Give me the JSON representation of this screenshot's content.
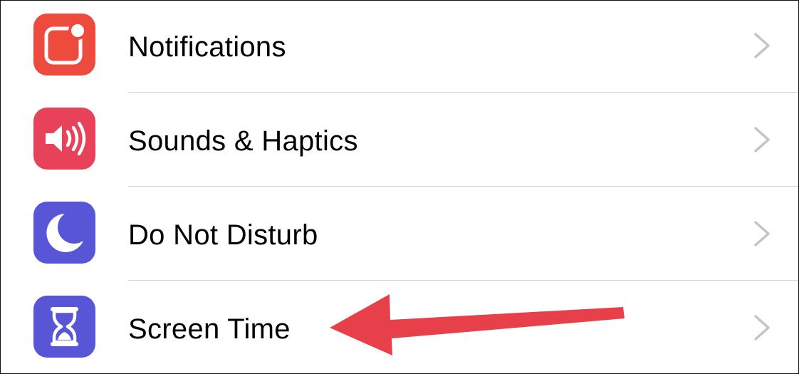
{
  "settings": {
    "items": [
      {
        "label": "Notifications",
        "icon": "notifications-icon",
        "color": "#EC4B3D"
      },
      {
        "label": "Sounds & Haptics",
        "icon": "speaker-icon",
        "color": "#E8425A"
      },
      {
        "label": "Do Not Disturb",
        "icon": "moon-icon",
        "color": "#5856D6"
      },
      {
        "label": "Screen Time",
        "icon": "hourglass-icon",
        "color": "#5856D6"
      }
    ],
    "chevron_icon": "chevron-right-icon",
    "separator_color": "#D4D4D8",
    "chevron_color": "#C4C4C7"
  },
  "annotation": {
    "arrow_icon": "red-arrow-annotation",
    "arrow_color": "#E8404A"
  }
}
